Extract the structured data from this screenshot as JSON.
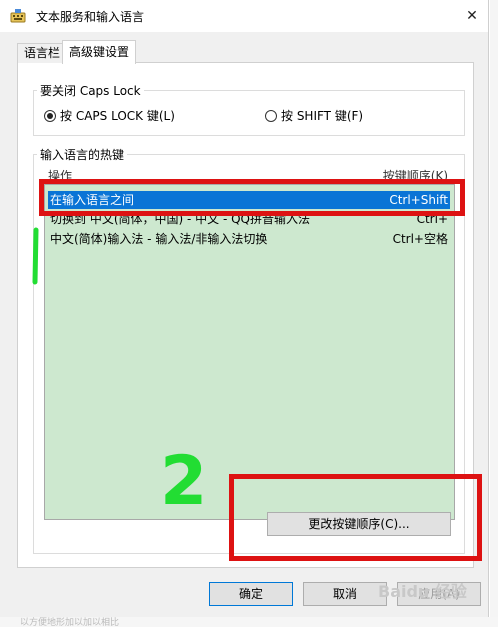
{
  "window": {
    "title": "文本服务和输入语言",
    "close_label": "✕"
  },
  "tabs": [
    {
      "label": "语言栏"
    },
    {
      "label": "高级键设置"
    }
  ],
  "caps_group": {
    "title": "要关闭 Caps Lock",
    "option_capslock": "按 CAPS LOCK 键(L)",
    "option_shift": "按 SHIFT 键(F)",
    "selected": "option_capslock"
  },
  "hotkeys": {
    "title": "输入语言的热键",
    "col_action": "操作",
    "col_keys": "按键顺序(K)",
    "rows": [
      {
        "action": "在输入语言之间",
        "keys": "Ctrl+Shift",
        "selected": true
      },
      {
        "action": "切换到 中文(简体，中国) - 中文 - QQ拼音输入法",
        "keys": "Ctrl+"
      },
      {
        "action": "中文(简体)输入法 - 输入法/非输入法切换",
        "keys": "Ctrl+空格"
      }
    ],
    "change_button": "更改按键顺序(C)..."
  },
  "footer": {
    "ok": "确定",
    "cancel": "取消",
    "apply": "应用(A)"
  },
  "annotations": {
    "mark_two": "2",
    "mark_color": "#22dd33",
    "box_color": "#dd1212"
  },
  "watermark": "Baidu 经验",
  "bottom_fragment": "以方便地形加以加以相比"
}
